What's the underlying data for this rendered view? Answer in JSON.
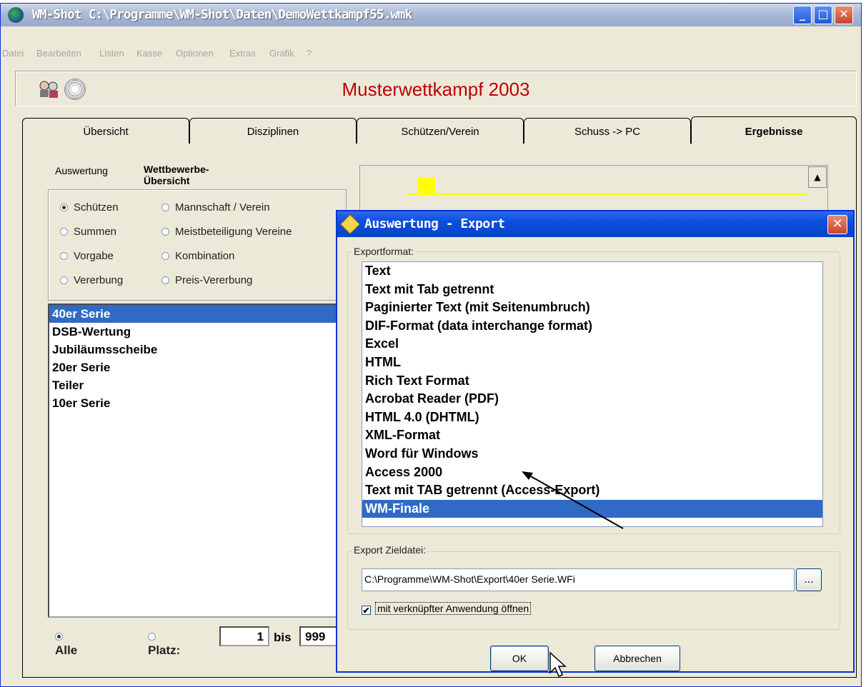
{
  "window": {
    "title": "WM-Shot C:\\Programme\\WM-Shot\\Daten\\DemoWettkampf55.wmk"
  },
  "menu": [
    "Datei",
    "Bearbeiten",
    "Listen",
    "Kasse",
    "Optionen",
    "Extras",
    "Grafik",
    "?"
  ],
  "header": {
    "title": "Musterwettkampf 2003"
  },
  "tabs": [
    "Übersicht",
    "Disziplinen",
    "Schützen/Verein",
    "Schuss -> PC",
    "Ergebnisse"
  ],
  "subtabs": [
    "Auswertung",
    "Wettbewerbe-Übersicht"
  ],
  "radios": [
    "Schützen",
    "Mannschaft / Verein",
    "Summen",
    "Meistbeteiligung Vereine",
    "Vorgabe",
    "Kombination",
    "Vererbung",
    "Preis-Vererbung"
  ],
  "competitions": [
    "40er Serie",
    "DSB-Wertung",
    "Jubiläumsscheibe",
    "20er Serie",
    "Teiler",
    "10er Serie"
  ],
  "bottom": {
    "alle": "Alle",
    "platz": "Platz:",
    "from": "1",
    "bis": "bis",
    "to": "999"
  },
  "dialog": {
    "title": "Auswertung - Export",
    "group_format": "Exportformat:",
    "formats": [
      "Text",
      "Text mit Tab getrennt",
      "Paginierter Text (mit Seitenumbruch)",
      "DIF-Format (data interchange format)",
      "Excel",
      "HTML",
      "Rich Text Format",
      "Acrobat Reader (PDF)",
      "HTML 4.0 (DHTML)",
      "XML-Format",
      "Word für Windows",
      "Access 2000",
      "Text mit TAB getrennt (Access-Export)",
      "WM-Finale"
    ],
    "group_target": "Export Zieldatei:",
    "path": "C:\\Programme\\WM-Shot\\Export\\40er Serie.WFi",
    "browse": "...",
    "checkbox_label": "mit verknüpfter Anwendung öffnen",
    "ok": "OK",
    "cancel": "Abbrechen"
  }
}
